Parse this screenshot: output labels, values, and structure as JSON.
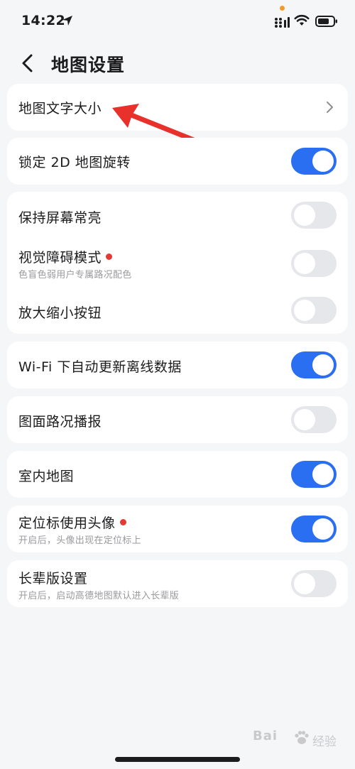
{
  "status_bar": {
    "time": "14:22"
  },
  "nav": {
    "title": "地图设置"
  },
  "settings": {
    "map_text_size": "地图文字大小",
    "lock_2d": "锁定 2D 地图旋转",
    "keep_screen_on": "保持屏幕常亮",
    "vision_mode": "视觉障碍模式",
    "vision_mode_sub": "色盲色弱用户专属路况配色",
    "zoom_buttons": "放大缩小按钮",
    "wifi_update": "Wi-Fi 下自动更新离线数据",
    "traffic_broadcast": "图面路况播报",
    "indoor_map": "室内地图",
    "avatar_marker": "定位标使用头像",
    "avatar_marker_sub": "开启后，头像出现在定位标上",
    "elder_mode": "长辈版设置",
    "elder_mode_sub": "开启后，启动高德地图默认进入长辈版"
  },
  "toggles": {
    "lock_2d": true,
    "keep_screen_on": false,
    "vision_mode": false,
    "zoom_buttons": false,
    "wifi_update": true,
    "traffic_broadcast": false,
    "indoor_map": true,
    "avatar_marker": true,
    "elder_mode": false
  },
  "watermark": {
    "brand": "Bai",
    "suffix": "经验"
  },
  "colors": {
    "toggle_on": "#2a6ef2",
    "toggle_off": "#e6e7ea",
    "badge_red": "#e53935",
    "annotation_red": "#e8312b",
    "background": "#f5f6f8"
  }
}
